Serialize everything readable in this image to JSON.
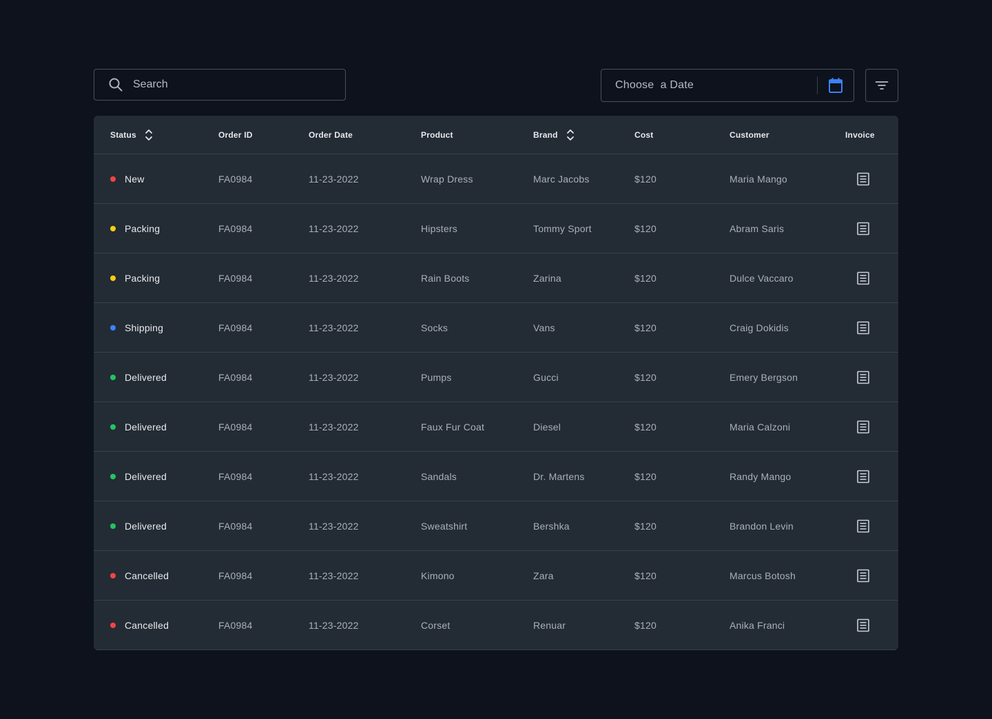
{
  "search": {
    "placeholder": "Search",
    "icon": "search-icon"
  },
  "date_picker": {
    "label": "Choose  a Date",
    "icon": "calendar-icon",
    "icon_color": "#3b82f6"
  },
  "filter": {
    "icon": "filter-icon"
  },
  "table": {
    "headers": {
      "status": "Status",
      "order_id": "Order ID",
      "order_date": "Order Date",
      "product": "Product",
      "brand": "Brand",
      "cost": "Cost",
      "customer": "Customer",
      "invoice": "Invoice"
    },
    "status_colors": {
      "New": "#ef4444",
      "Packing": "#facc15",
      "Shipping": "#3b82f6",
      "Delivered": "#22c55e",
      "Cancelled": "#ef4444"
    },
    "rows": [
      {
        "status": "New",
        "order_id": "FA0984",
        "order_date": "11-23-2022",
        "product": "Wrap Dress",
        "brand": "Marc Jacobs",
        "cost": "$120",
        "customer": "Maria Mango"
      },
      {
        "status": "Packing",
        "order_id": "FA0984",
        "order_date": "11-23-2022",
        "product": "Hipsters",
        "brand": "Tommy Sport",
        "cost": "$120",
        "customer": "Abram Saris"
      },
      {
        "status": "Packing",
        "order_id": "FA0984",
        "order_date": "11-23-2022",
        "product": "Rain Boots",
        "brand": "Zarina",
        "cost": "$120",
        "customer": "Dulce Vaccaro"
      },
      {
        "status": "Shipping",
        "order_id": "FA0984",
        "order_date": "11-23-2022",
        "product": "Socks",
        "brand": "Vans",
        "cost": "$120",
        "customer": "Craig Dokidis"
      },
      {
        "status": "Delivered",
        "order_id": "FA0984",
        "order_date": "11-23-2022",
        "product": "Pumps",
        "brand": "Gucci",
        "cost": "$120",
        "customer": "Emery Bergson"
      },
      {
        "status": "Delivered",
        "order_id": "FA0984",
        "order_date": "11-23-2022",
        "product": "Faux Fur Coat",
        "brand": "Diesel",
        "cost": "$120",
        "customer": "Maria Calzoni"
      },
      {
        "status": "Delivered",
        "order_id": "FA0984",
        "order_date": "11-23-2022",
        "product": "Sandals",
        "brand": "Dr. Martens",
        "cost": "$120",
        "customer": "Randy Mango"
      },
      {
        "status": "Delivered",
        "order_id": "FA0984",
        "order_date": "11-23-2022",
        "product": "Sweatshirt",
        "brand": "Bershka",
        "cost": "$120",
        "customer": "Brandon Levin"
      },
      {
        "status": "Cancelled",
        "order_id": "FA0984",
        "order_date": "11-23-2022",
        "product": "Kimono",
        "brand": "Zara",
        "cost": "$120",
        "customer": "Marcus Botosh"
      },
      {
        "status": "Cancelled",
        "order_id": "FA0984",
        "order_date": "11-23-2022",
        "product": "Corset",
        "brand": "Renuar",
        "cost": "$120",
        "customer": "Anika Franci"
      }
    ]
  }
}
